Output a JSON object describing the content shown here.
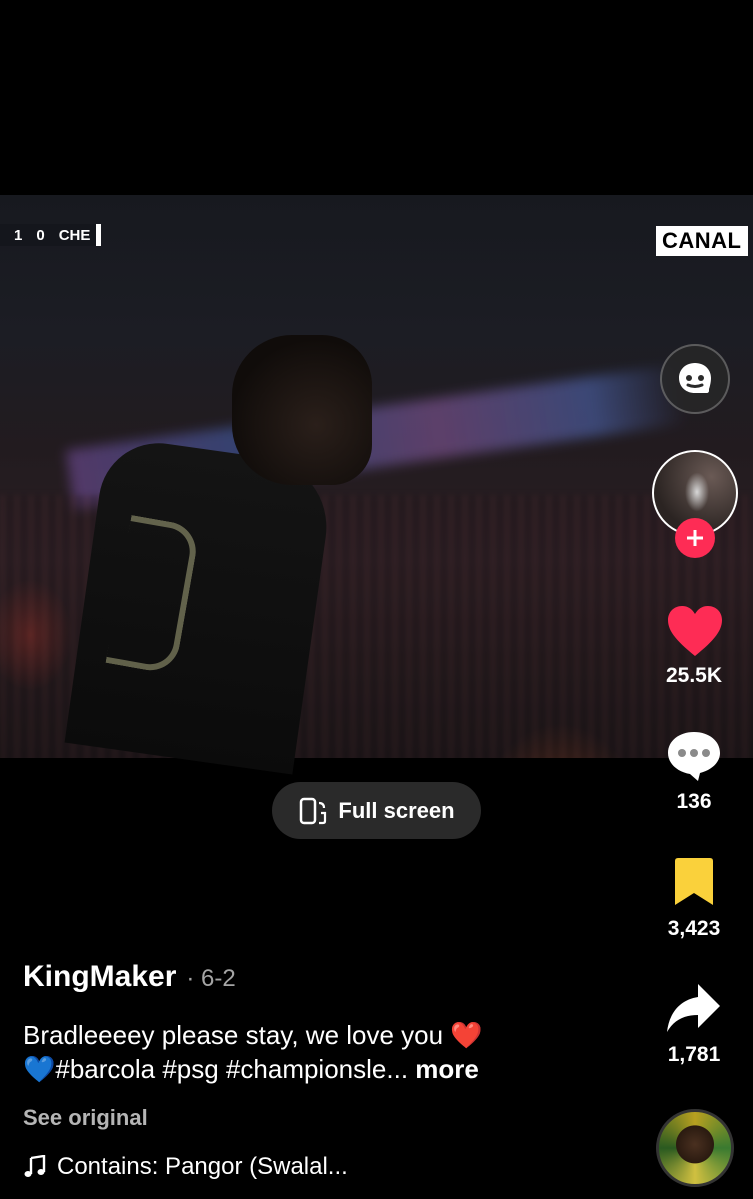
{
  "video": {
    "scoreboard": {
      "home_goals": "1",
      "away_goals": "0",
      "away_team": "CHE"
    },
    "broadcaster_logo": "CANAL"
  },
  "rail": {
    "qa_icon": "question-answer-icon",
    "follow_icon": "plus-icon",
    "likes": "25.5K",
    "comments": "136",
    "saves": "3,423",
    "shares": "1,781",
    "colors": {
      "like": "#fe2c55",
      "save": "#fad13b",
      "follow": "#fe2c55"
    }
  },
  "fullscreen": {
    "label": "Full screen",
    "icon": "fullscreen-rotate-icon"
  },
  "post": {
    "author": "KingMaker",
    "date": "· 6-2",
    "caption_line1": "Bradleeeey please stay, we love you ❤️",
    "caption_line2": "💙#barcola #psg #championsle...",
    "more_label": "more",
    "see_original": "See original",
    "music_icon": "music-note-icon",
    "music": "Contains: Pangor (Swalal..."
  }
}
